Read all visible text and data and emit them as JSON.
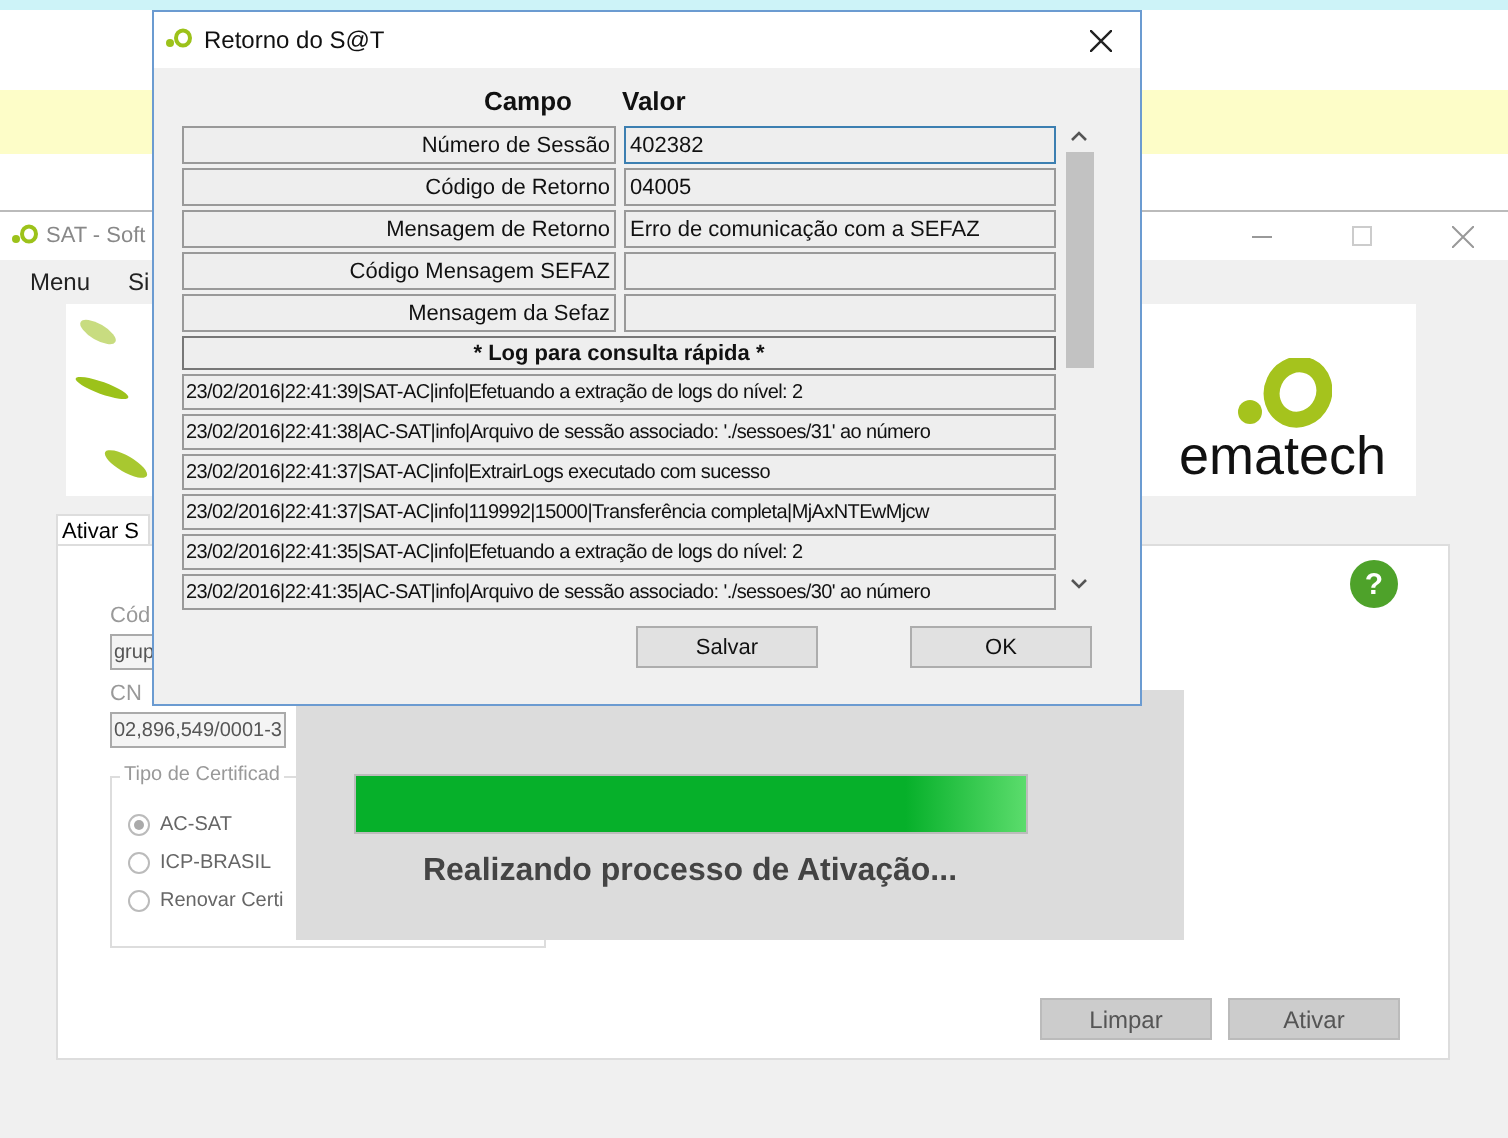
{
  "main_window": {
    "title": "SAT - Soft",
    "menu": [
      "Menu",
      "Si"
    ],
    "logo_text": "ematech",
    "tab": {
      "label": "Ativar S",
      "selected": true
    },
    "fields": [
      {
        "label": "Cód",
        "value": "grup"
      },
      {
        "label": "CN",
        "value": "02,896,549/0001-3"
      }
    ],
    "certificate_group": {
      "title": "Tipo de Certificad",
      "options": [
        {
          "label": "AC-SAT",
          "selected": true
        },
        {
          "label": "ICP-BRASIL",
          "selected": false
        },
        {
          "label": "Renovar Certi",
          "selected": false
        }
      ]
    },
    "help_label": "?",
    "buttons": [
      "Limpar",
      "Ativar"
    ]
  },
  "progress_overlay": {
    "level": 1,
    "message": "Realizando processo de Ativação..."
  },
  "dialog": {
    "title": "Retorno do S@T",
    "columns": [
      "Campo",
      "Valor"
    ],
    "rows": [
      {
        "field": "Número de Sessão",
        "value": "402382",
        "focused": true
      },
      {
        "field": "Código de Retorno",
        "value": "04005",
        "focused": false
      },
      {
        "field": "Mensagem de Retorno",
        "value": "Erro de comunicação com a SEFAZ",
        "focused": false
      },
      {
        "field": "Código Mensagem SEFAZ",
        "value": "",
        "focused": false
      },
      {
        "field": "Mensagem da Sefaz",
        "value": "",
        "focused": false
      }
    ],
    "log_title": "* Log para consulta rápida *",
    "log_lines": [
      "23/02/2016|22:41:39|SAT-AC|info|Efetuando a extração de logs do nível: 2",
      "23/02/2016|22:41:38|AC-SAT|info|Arquivo de sessão associado: './sessoes/31' ao número",
      "23/02/2016|22:41:37|SAT-AC|info|ExtrairLogs executado com sucesso",
      "23/02/2016|22:41:37|SAT-AC|info|119992|15000|Transferência completa|MjAxNTEwMjcw",
      "23/02/2016|22:41:35|SAT-AC|info|Efetuando a extração de logs do nível: 2",
      "23/02/2016|22:41:35|AC-SAT|info|Arquivo de sessão associado: './sessoes/30' ao número"
    ],
    "buttons": [
      "Salvar",
      "OK"
    ]
  }
}
